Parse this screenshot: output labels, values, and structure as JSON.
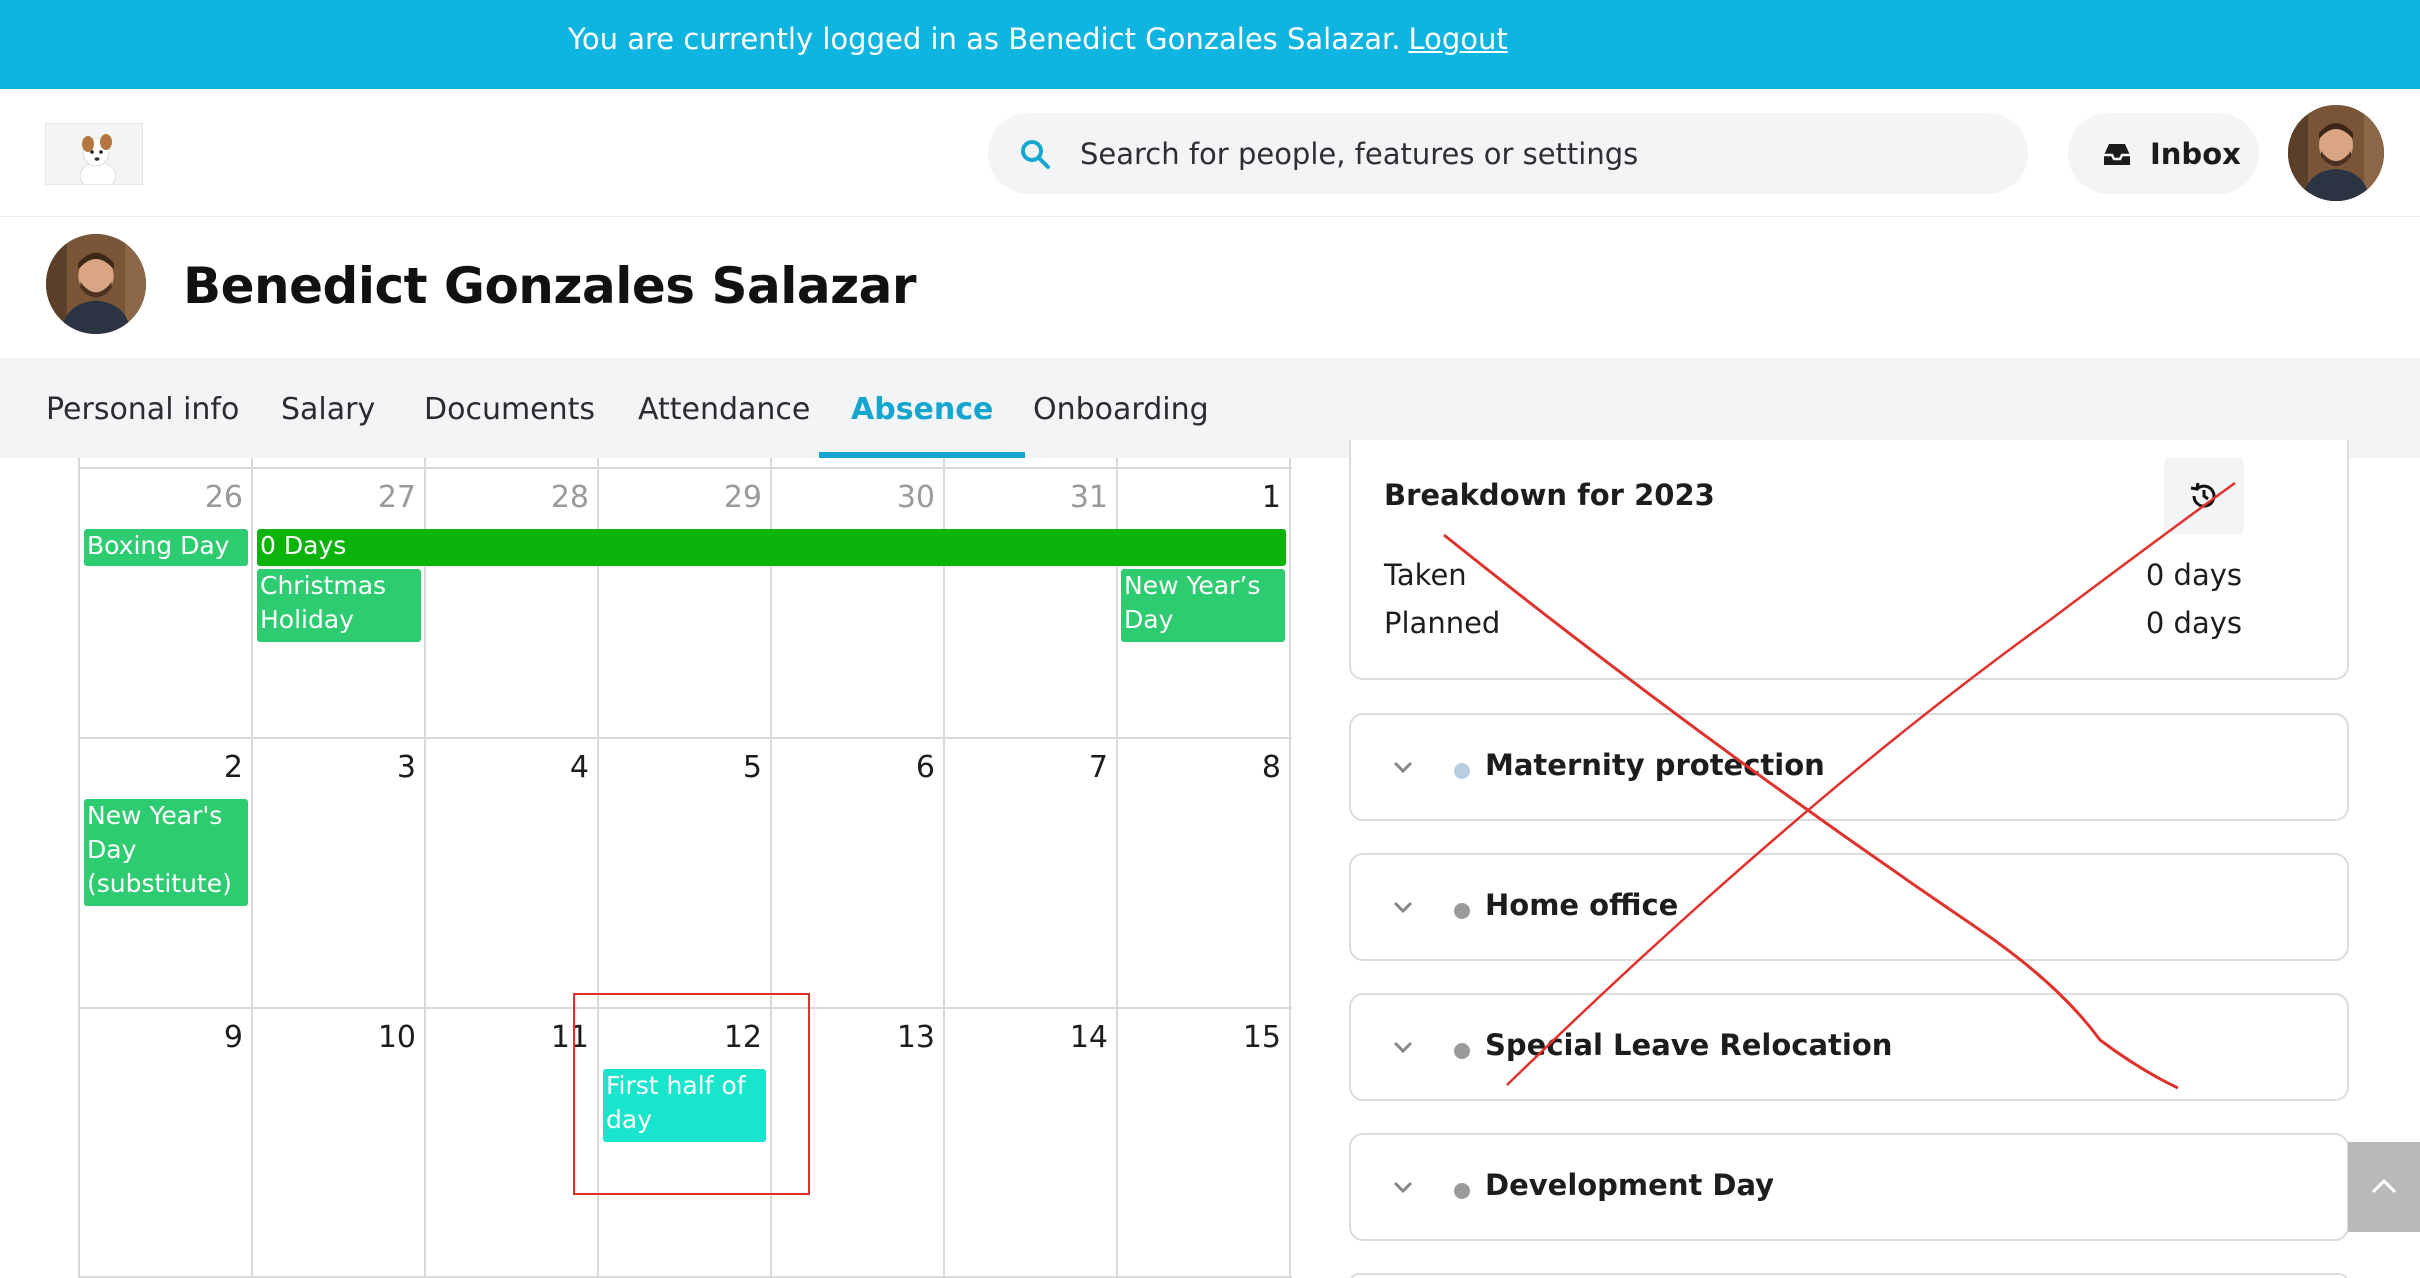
{
  "banner": {
    "text": "You are currently logged in as Benedict Gonzales Salazar.",
    "logout": "Logout"
  },
  "header": {
    "search_placeholder": "Search for people, features or settings",
    "inbox_label": "Inbox"
  },
  "profile": {
    "name": "Benedict Gonzales Salazar"
  },
  "tabs": [
    "Personal info",
    "Salary",
    "Documents",
    "Attendance",
    "Absence",
    "Onboarding"
  ],
  "active_tab": "Absence",
  "calendar": {
    "weeks": [
      [
        "26",
        "27",
        "28",
        "29",
        "30",
        "31",
        "1"
      ],
      [
        "2",
        "3",
        "4",
        "5",
        "6",
        "7",
        "8"
      ],
      [
        "9",
        "10",
        "11",
        "12",
        "13",
        "14",
        "15"
      ]
    ],
    "events": {
      "boxing_day": "Boxing Day",
      "zero_days": "0 Days",
      "christmas_holiday": "Christmas Holiday",
      "new_years_day": "New Year’s Day",
      "new_years_day_sub": "New Year's Day (substitute)",
      "first_half": "First half of day"
    }
  },
  "breakdown": {
    "title": "Breakdown for 2023",
    "taken_label": "Taken",
    "taken_value": "0 days",
    "planned_label": "Planned",
    "planned_value": "0 days"
  },
  "absence_types": [
    "Maternity protection",
    "Home office",
    "Special Leave Relocation",
    "Development Day"
  ],
  "colors": {
    "brand": "#0eb5e0",
    "accent": "#14a6cf",
    "event_green": "#2ecc71",
    "event_dark_green": "#0bb30b",
    "event_teal": "#17e6cc",
    "annotation_red": "#e0322d"
  }
}
